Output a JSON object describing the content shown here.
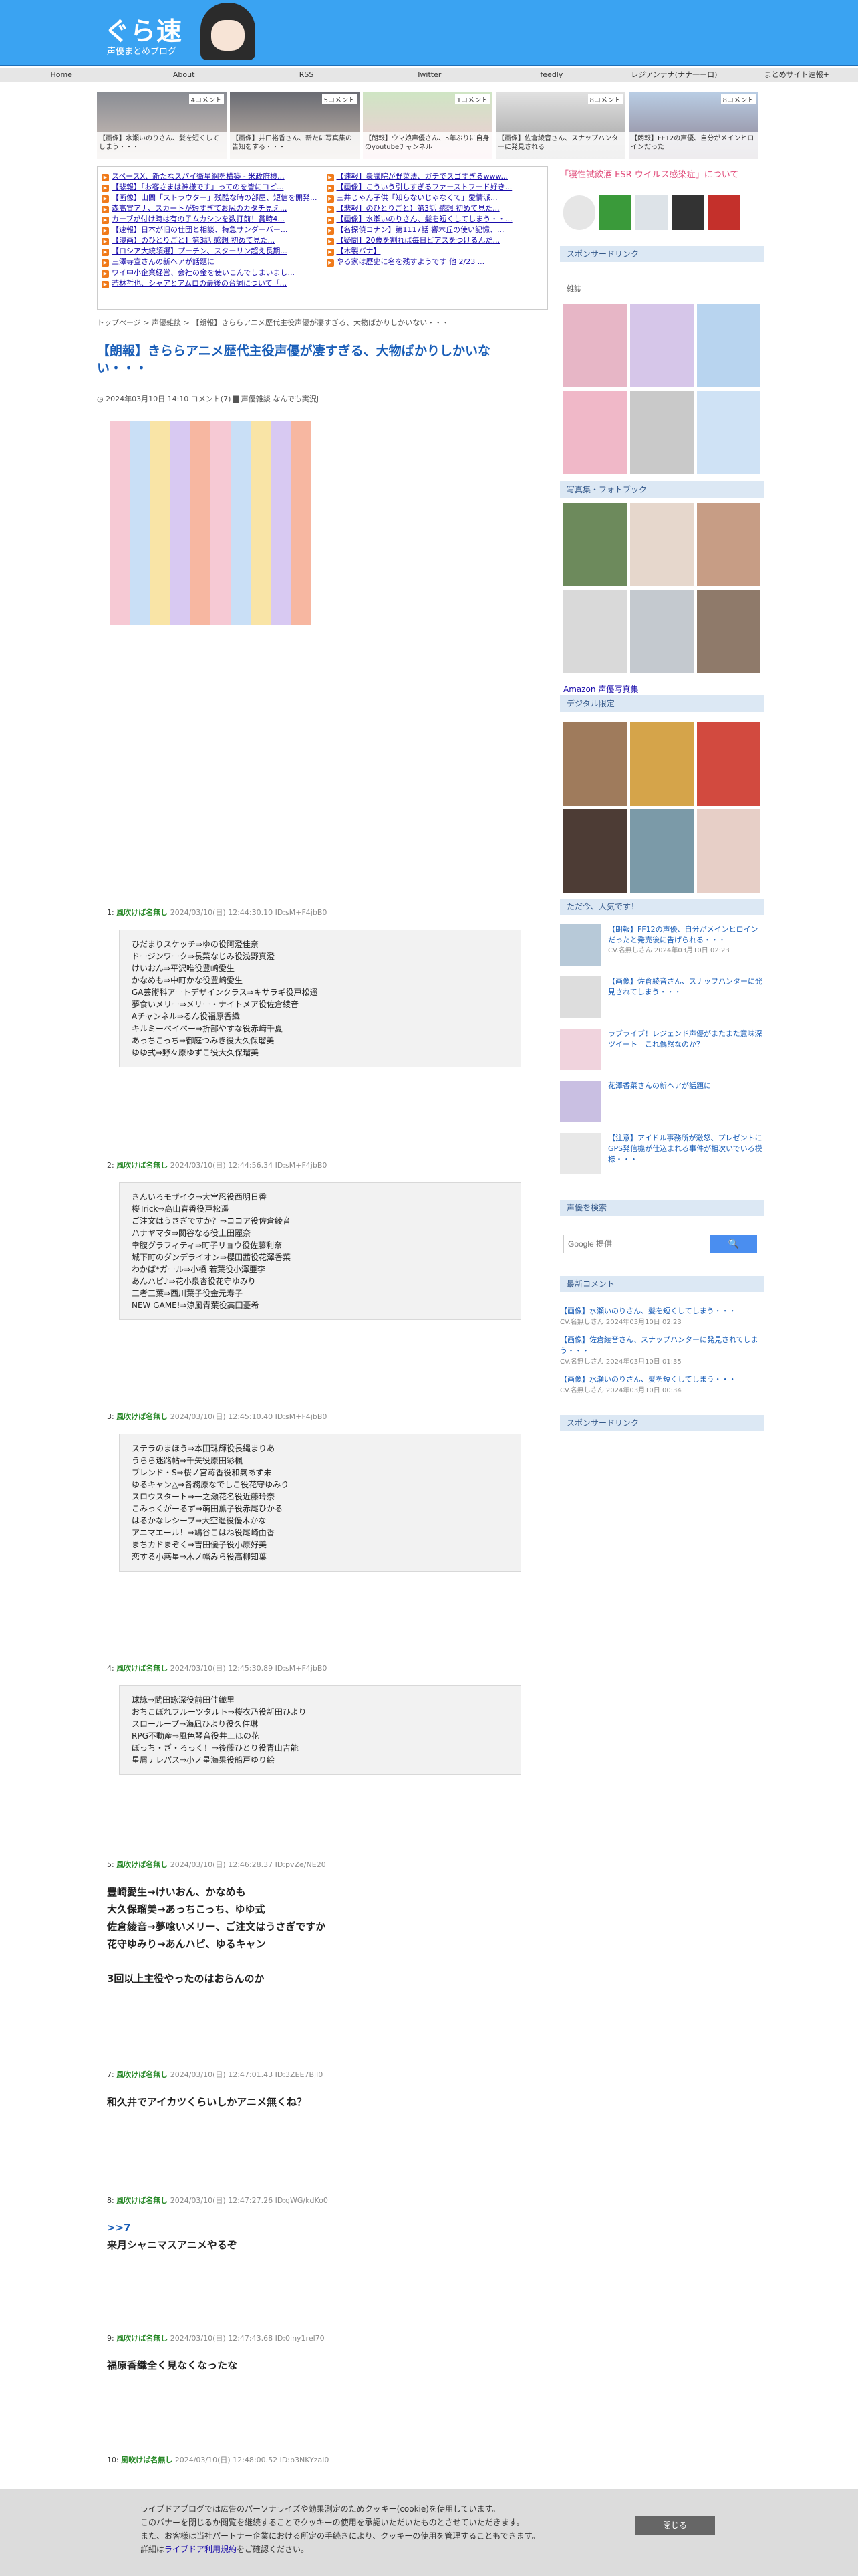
{
  "logo": {
    "title": "ぐら速",
    "subtitle": "声優まとめブログ"
  },
  "nav": [
    "Home",
    "About",
    "RSS",
    "Twitter",
    "feedly",
    "レジアンテナ(ナナ一ーロ)",
    "まとめサイト速報+"
  ],
  "tiles": [
    {
      "count": "4コメント",
      "caption": "【画像】水瀬いのりさん、髪を短くしてしまう・・・"
    },
    {
      "count": "5コメント",
      "caption": "【画像】井口裕香さん、新たに写真集の告知をする・・・"
    },
    {
      "count": "1コメント",
      "caption": "【朗報】ウマ娘声優さん、5年ぶりに自身のyoutubeチャンネル"
    },
    {
      "count": "8コメント",
      "caption": "【画像】佐倉綾音さん、スナップハンターに発見される"
    },
    {
      "count": "8コメント",
      "caption": "【朗報】FF12の声優、自分がメインヒロインだった"
    }
  ],
  "links": [
    "スペースX、新たなスパイ衛星網を構築 - 米政府機...",
    "【速報】衆議院が野菜法、ガチでスゴすぎるwww...",
    "【悲報】「お客さまは神様です」ってのを皆にコピ...",
    "【画像】こういう引しすぎるファーストフード好き...",
    "【画像】山間「ストラウター」残酷な時の部屋、短信を開発...",
    "三井じゃん子供「知らないじゃなくて」愛情派...",
    "森高宣アナ、スカートが短すぎてお尻のカタチ見え...",
    "【悲報】のひとりごと】第3話 感想 初めて見た...",
    "カーブが付け時は有の子ムカシンを数打前！賞時4...",
    "【画像】水瀬いのりさん、髪を短くしてしまう・・...",
    "【速報】日本が旧の仕団と相談、特急サンダーバー...",
    "【名探偵コナン】第1117話 響木丘の使い記憶、...",
    "【漫画】のひとりごと】第3話 感想 初めて見た...",
    "【疑問】20歳を割れば毎日ビアスをつけるんだ...",
    "【ロシア大統領選】プーチン、スターリン超え長期...",
    "【木製バナ】",
    "三澤寺宣さんの新ヘアが話題に",
    "やる家は歴史に名を残すようです 他 2/23 ...",
    "ワイ中小企業経営、会社の金を使いこんでしまいまし...",
    "",
    "若林哲也、シャアとアムロの最後の台詞について「...",
    ""
  ],
  "breadcrumb": "トップページ > 声優雑談 > 【朗報】きららアニメ歴代主役声優が凄すぎる、大物ばかりしかいない・・・",
  "article": {
    "title": "【朗報】きららアニメ歴代主役声優が凄すぎる、大物ばかりしかいない・・・",
    "meta": "◷ 2024年03月10日 14:10 コメント(7)  ▇ 声優雑談 なんでも実況J"
  },
  "posts": [
    {
      "no": "1:",
      "name": "風吹けば名無し",
      "date": "2024/03/10(日) 12:44:30.10 ID:sM+F4jbB0",
      "lines": [
        "ひだまりスケッチ⇒ゆの役阿澄佳奈",
        "ドージンワーク⇒長菜なじみ役浅野真澄",
        "けいおん⇒平沢唯役豊崎愛生",
        "かなめも⇒中町かな役豊崎愛生",
        "GA芸術科アートデザインクラス⇒キサラギ役戸松遥",
        "夢食いメリー⇒メリー・ナイトメア役佐倉綾音",
        "Aチャンネル⇒るん役福原香織",
        "キルミーベイベー⇒折部やすな役赤﨑千夏",
        "あっちこっち⇒御庭つみき役大久保瑠美",
        "ゆゆ式⇒野々原ゆずこ役大久保瑠美"
      ]
    },
    {
      "no": "2:",
      "name": "風吹けば名無し",
      "date": "2024/03/10(日) 12:44:56.34 ID:sM+F4jbB0",
      "lines": [
        "きんいろモザイク⇒大宮忍役西明日香",
        "桜Trick⇒高山春香役戸松遥",
        "ご注文はうさぎですか？⇒ココア役佐倉綾音",
        "ハナヤマタ⇒関谷なる役上田麗奈",
        "幸腹グラフィティ⇒町子リョウ役佐藤利奈",
        "城下町のダンデライオン⇒櫻田茜役花澤香菜",
        "わかば*ガール⇒小橋 若葉役小澤亜李",
        "あんハピ♪⇒花小泉杏役花守ゆみり",
        "三者三葉⇒西川葉子役金元寿子",
        "NEW GAME!⇒涼風青葉役高田憂希"
      ]
    },
    {
      "no": "3:",
      "name": "風吹けば名無し",
      "date": "2024/03/10(日) 12:45:10.40 ID:sM+F4jbB0",
      "lines": [
        "ステラのまほう⇒本田珠輝役長縄まりあ",
        "うらら迷路帖⇒千矢役原田彩楓",
        "ブレンド・S⇒桜ノ宮苺香役和氣あず未",
        "ゆるキャン△⇒各務原なでしこ役花守ゆみり",
        "スロウスタート⇒一之瀬花名役近藤玲奈",
        "こみっくがーるず⇒萌田薫子役赤尾ひかる",
        "はるかなレシーブ⇒大空遥役優木かな",
        "アニマエール！⇒鳩谷こはね役尾崎由香",
        "まちカドまぞく⇒吉田優子役小原好美",
        "恋する小惑星⇒木ノ幡みら役高柳知葉"
      ]
    },
    {
      "no": "4:",
      "name": "風吹けば名無し",
      "date": "2024/03/10(日) 12:45:30.89 ID:sM+F4jbB0",
      "lines": [
        "球詠⇒武田詠深役前田佳織里",
        "おちこぼれフルーツタルト⇒桜衣乃役新田ひより",
        "スローループ⇒海凪ひより役久住琳",
        "RPG不動産⇒風色琴音役井上ほの花",
        "ぼっち・ざ・ろっく！⇒後藤ひとり役青山吉能",
        "星屑テレパス⇒小ノ星海果役船戸ゆり絵"
      ]
    },
    {
      "no": "5:",
      "name": "風吹けば名無し",
      "date": "2024/03/10(日) 12:46:28.37 ID:pvZe/NE20",
      "lines": [
        "豊崎愛生→けいおん、かなめも",
        "大久保瑠美→あっちこっち、ゆゆ式",
        "佐倉綾音→夢喰いメリー、ご注文はうさぎですか",
        "花守ゆみり→あんハピ、ゆるキャン",
        "",
        "3回以上主役やったのはおらんのか"
      ]
    },
    {
      "no": "7:",
      "name": "風吹けば名無し",
      "date": "2024/03/10(日) 12:47:01.43 ID:3ZEE7BjI0",
      "lines": [
        "和久井でアイカツくらいしかアニメ無くね？"
      ]
    },
    {
      "no": "8:",
      "name": "風吹けば名無し",
      "date": "2024/03/10(日) 12:47:27.26 ID:gWG/kdKo0",
      "anchor": ">>7",
      "lines": [
        "来月シャニマスアニメやるぞ"
      ]
    },
    {
      "no": "9:",
      "name": "風吹けば名無し",
      "date": "2024/03/10(日) 12:47:43.68 ID:0iny1rel70",
      "lines": [
        "福原香織全く見なくなったな"
      ]
    },
    {
      "no": "10:",
      "name": "風吹けば名無し",
      "date": "2024/03/10(日) 12:48:00.52 ID:b3NKYzai0",
      "lines": []
    }
  ],
  "sidebar": {
    "banner_text": "「寝性試飲酒 ESR ウイルス感染症」について",
    "ad_heading": "スポンサードリンク",
    "zasshi": "雑誌",
    "photobook": "写真集・フォトブック",
    "amazon": "Amazon 声優写真集",
    "digital": "デジタル限定",
    "popular": "ただ今、人気です！",
    "recos": [
      {
        "t": "【朗報】FF12の声優、自分がメインヒロインだったと発売後に告げられる・・・",
        "s": "CV.名無しさん 2024年03月10日 02:23"
      },
      {
        "t": "【画像】佐倉綾音さん、スナップハンターに発見されてしまう・・・",
        "s": ""
      },
      {
        "t": "ラブライブ！レジェンド声優がまたまた意味深ツイート　これ偶然なのか？",
        "s": ""
      },
      {
        "t": "花澤香菜さんの新ヘアが話題に",
        "s": ""
      },
      {
        "t": "【注意】アイドル事務所が激怒、プレゼントにGPS発信機が仕込まれる事件が相次いでいる模様・・・",
        "s": ""
      }
    ],
    "search_title": "声優を検索",
    "search_placeholder": "Google 提供",
    "search_btn": "🔍",
    "recent_title": "最新コメント",
    "recent": [
      {
        "t": "【画像】水瀬いのりさん、髪を短くしてしまう・・・",
        "s": "CV.名無しさん 2024年03月10日 02:23"
      },
      {
        "t": "【画像】佐倉綾音さん、スナップハンターに発見されてしまう・・・",
        "s": "CV.名無しさん 2024年03月10日 01:35"
      },
      {
        "t": "【画像】水瀬いのりさん、髪を短くしてしまう・・・",
        "s": "CV.名無しさん 2024年03月10日 00:34"
      }
    ],
    "ad2": "スポンサードリンク"
  },
  "cookie": {
    "l1": "ライブドアブログでは広告のパーソナライズや効果測定のためクッキー(cookie)を使用しています。",
    "l2": "このバナーを閉じるか閲覧を継続することでクッキーの使用を承認いただいたものとさせていただきます。",
    "l3": "また、お客様は当社パートナー企業における所定の手続きにより、クッキーの使用を管理することもできます。",
    "l4a": "詳細は",
    "l4link": "ライブドア利用規約",
    "l4b": "をご確認ください。",
    "btn": "閉じる"
  },
  "colors": {
    "header": "#3aa3f2",
    "accent": "#1a5eb8",
    "name": "#2a8a2a"
  }
}
